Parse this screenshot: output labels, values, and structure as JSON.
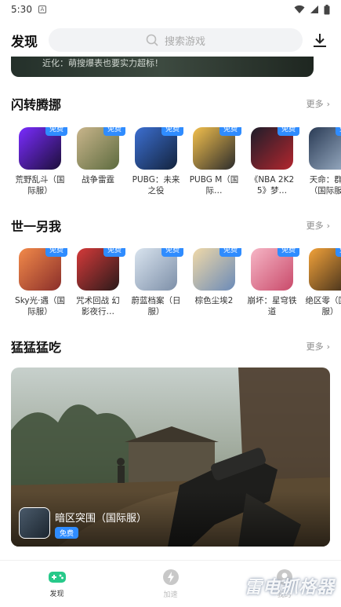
{
  "status": {
    "time": "5:30",
    "notif_icon": "A"
  },
  "header": {
    "title": "发现",
    "search_placeholder": "搜索游戏"
  },
  "top_banner": {
    "text": "近化：萌搜爆表也要实力超标！"
  },
  "sections": [
    {
      "title": "闪转腾挪",
      "more": "更多",
      "games": [
        {
          "name": "荒野乱斗（国际服）",
          "free": "免费",
          "colors": [
            "#7a2cff",
            "#1d0f3a"
          ]
        },
        {
          "name": "战争雷霆",
          "free": "免费",
          "colors": [
            "#c9b58b",
            "#5d6b3f"
          ]
        },
        {
          "name": "PUBG：未来之役",
          "free": "免费",
          "colors": [
            "#3c6fd1",
            "#13233d"
          ]
        },
        {
          "name": "PUBG M（国际…",
          "free": "免费",
          "colors": [
            "#f3c04d",
            "#2c2c2c"
          ]
        },
        {
          "name": "《NBA 2K25》梦…",
          "free": "免费",
          "colors": [
            "#1d1d2a",
            "#b3262e"
          ]
        },
        {
          "name": "天命：群星（国际服）",
          "free": "免费",
          "colors": [
            "#2a3b55",
            "#9fb2c8"
          ]
        }
      ]
    },
    {
      "title": "世一另我",
      "more": "更多",
      "games": [
        {
          "name": "Sky光·遇（国际服）",
          "free": "免费",
          "colors": [
            "#f28a4a",
            "#8a2e2a"
          ]
        },
        {
          "name": "咒术回战 幻影夜行…",
          "free": "免费",
          "colors": [
            "#d53a3a",
            "#2a1a1a"
          ]
        },
        {
          "name": "蔚蓝档案（日服）",
          "free": "免费",
          "colors": [
            "#d9e4ef",
            "#7d8fa8"
          ]
        },
        {
          "name": "棕色尘埃2",
          "free": "免费",
          "colors": [
            "#f0d9a8",
            "#6a8ab8"
          ]
        },
        {
          "name": "崩坏：星穹铁道",
          "free": "免费",
          "colors": [
            "#f6b6c6",
            "#c94a6a"
          ]
        },
        {
          "name": "绝区零（国际服）",
          "free": "免费",
          "colors": [
            "#f2a23a",
            "#3a2a1a"
          ]
        }
      ]
    }
  ],
  "feature": {
    "section_title": "猛猛猛吃",
    "more": "更多",
    "game_name": "暗区突围（国际服）",
    "free": "免费"
  },
  "tabs": [
    {
      "label": "发现",
      "icon": "gamepad-icon",
      "active": true
    },
    {
      "label": "加速",
      "icon": "lightning-icon",
      "active": false
    },
    {
      "label": "我的",
      "icon": "profile-icon",
      "active": false
    }
  ],
  "watermark": "雷电抓格器"
}
